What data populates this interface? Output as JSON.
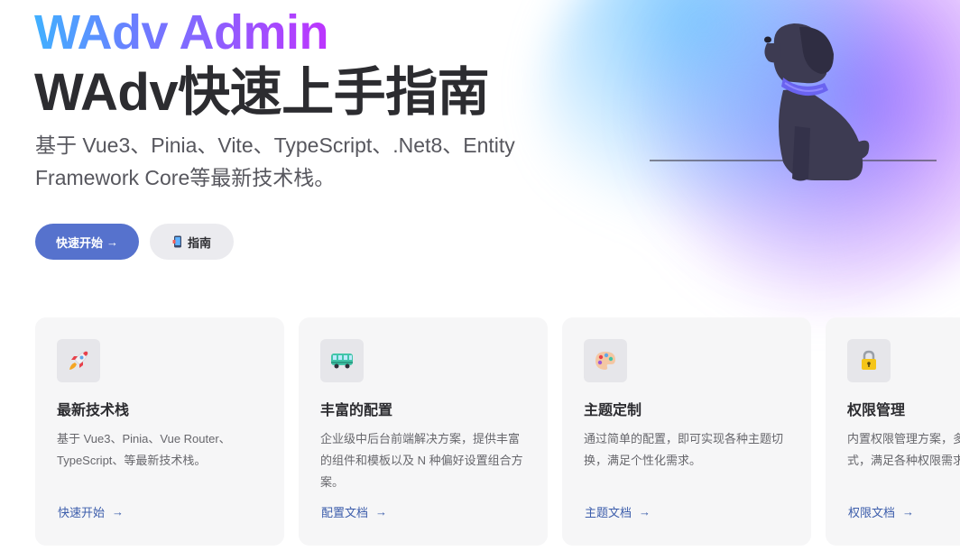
{
  "hero": {
    "name": "WAdv Admin",
    "title": "WAdv快速上手指南",
    "tagline": "基于 Vue3、Pinia、Vite、TypeScript、.Net8、Entity Framework Core等最新技术栈。"
  },
  "actions": {
    "primary_label": "快速开始",
    "primary_arrow": "→",
    "alt_label": "指南"
  },
  "colors": {
    "brand": "#5672cd",
    "name_gradient_start": "#41b0ff",
    "name_gradient_end": "#bd34fe",
    "link": "#3c5dab"
  },
  "features": [
    {
      "icon": "rocket-icon",
      "title": "最新技术栈",
      "desc": "基于 Vue3、Pinia、Vue Router、TypeScript、等最新技术栈。",
      "link": "快速开始",
      "arrow": "→"
    },
    {
      "icon": "bus-icon",
      "title": "丰富的配置",
      "desc": "企业级中后台前端解决方案，提供丰富的组件和模板以及 N 种偏好设置组合方案。",
      "link": "配置文档",
      "arrow": "→"
    },
    {
      "icon": "palette-icon",
      "title": "主题定制",
      "desc": "通过简单的配置，即可实现各种主题切换，满足个性化需求。",
      "link": "主题文档",
      "arrow": "→"
    },
    {
      "icon": "lock-icon",
      "title": "权限管理",
      "desc": "内置权限管理方案，多种权限控制方式，满足各种权限需求。",
      "link": "权限文档",
      "arrow": "→"
    }
  ]
}
